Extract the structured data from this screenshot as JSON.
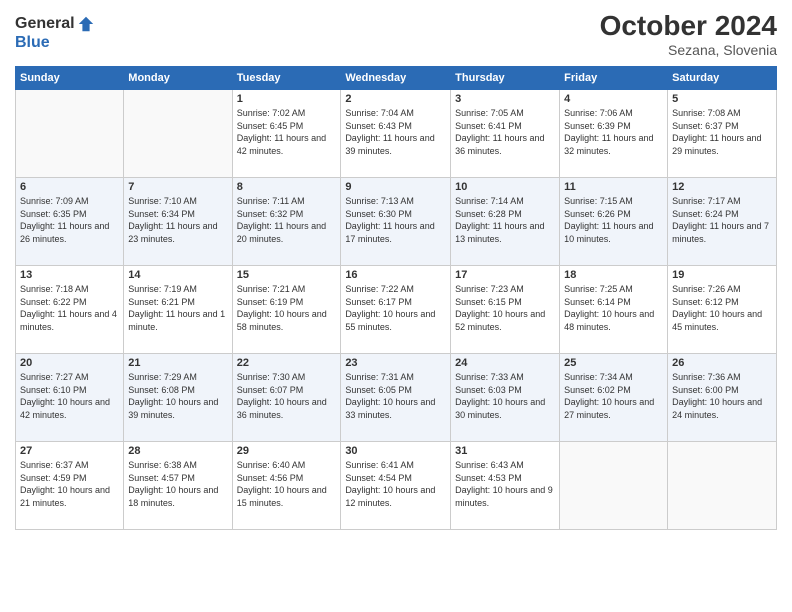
{
  "header": {
    "logo_line1": "General",
    "logo_line2": "Blue",
    "month": "October 2024",
    "location": "Sezana, Slovenia"
  },
  "weekdays": [
    "Sunday",
    "Monday",
    "Tuesday",
    "Wednesday",
    "Thursday",
    "Friday",
    "Saturday"
  ],
  "weeks": [
    [
      {
        "day": "",
        "info": ""
      },
      {
        "day": "",
        "info": ""
      },
      {
        "day": "1",
        "info": "Sunrise: 7:02 AM\nSunset: 6:45 PM\nDaylight: 11 hours and 42 minutes."
      },
      {
        "day": "2",
        "info": "Sunrise: 7:04 AM\nSunset: 6:43 PM\nDaylight: 11 hours and 39 minutes."
      },
      {
        "day": "3",
        "info": "Sunrise: 7:05 AM\nSunset: 6:41 PM\nDaylight: 11 hours and 36 minutes."
      },
      {
        "day": "4",
        "info": "Sunrise: 7:06 AM\nSunset: 6:39 PM\nDaylight: 11 hours and 32 minutes."
      },
      {
        "day": "5",
        "info": "Sunrise: 7:08 AM\nSunset: 6:37 PM\nDaylight: 11 hours and 29 minutes."
      }
    ],
    [
      {
        "day": "6",
        "info": "Sunrise: 7:09 AM\nSunset: 6:35 PM\nDaylight: 11 hours and 26 minutes."
      },
      {
        "day": "7",
        "info": "Sunrise: 7:10 AM\nSunset: 6:34 PM\nDaylight: 11 hours and 23 minutes."
      },
      {
        "day": "8",
        "info": "Sunrise: 7:11 AM\nSunset: 6:32 PM\nDaylight: 11 hours and 20 minutes."
      },
      {
        "day": "9",
        "info": "Sunrise: 7:13 AM\nSunset: 6:30 PM\nDaylight: 11 hours and 17 minutes."
      },
      {
        "day": "10",
        "info": "Sunrise: 7:14 AM\nSunset: 6:28 PM\nDaylight: 11 hours and 13 minutes."
      },
      {
        "day": "11",
        "info": "Sunrise: 7:15 AM\nSunset: 6:26 PM\nDaylight: 11 hours and 10 minutes."
      },
      {
        "day": "12",
        "info": "Sunrise: 7:17 AM\nSunset: 6:24 PM\nDaylight: 11 hours and 7 minutes."
      }
    ],
    [
      {
        "day": "13",
        "info": "Sunrise: 7:18 AM\nSunset: 6:22 PM\nDaylight: 11 hours and 4 minutes."
      },
      {
        "day": "14",
        "info": "Sunrise: 7:19 AM\nSunset: 6:21 PM\nDaylight: 11 hours and 1 minute."
      },
      {
        "day": "15",
        "info": "Sunrise: 7:21 AM\nSunset: 6:19 PM\nDaylight: 10 hours and 58 minutes."
      },
      {
        "day": "16",
        "info": "Sunrise: 7:22 AM\nSunset: 6:17 PM\nDaylight: 10 hours and 55 minutes."
      },
      {
        "day": "17",
        "info": "Sunrise: 7:23 AM\nSunset: 6:15 PM\nDaylight: 10 hours and 52 minutes."
      },
      {
        "day": "18",
        "info": "Sunrise: 7:25 AM\nSunset: 6:14 PM\nDaylight: 10 hours and 48 minutes."
      },
      {
        "day": "19",
        "info": "Sunrise: 7:26 AM\nSunset: 6:12 PM\nDaylight: 10 hours and 45 minutes."
      }
    ],
    [
      {
        "day": "20",
        "info": "Sunrise: 7:27 AM\nSunset: 6:10 PM\nDaylight: 10 hours and 42 minutes."
      },
      {
        "day": "21",
        "info": "Sunrise: 7:29 AM\nSunset: 6:08 PM\nDaylight: 10 hours and 39 minutes."
      },
      {
        "day": "22",
        "info": "Sunrise: 7:30 AM\nSunset: 6:07 PM\nDaylight: 10 hours and 36 minutes."
      },
      {
        "day": "23",
        "info": "Sunrise: 7:31 AM\nSunset: 6:05 PM\nDaylight: 10 hours and 33 minutes."
      },
      {
        "day": "24",
        "info": "Sunrise: 7:33 AM\nSunset: 6:03 PM\nDaylight: 10 hours and 30 minutes."
      },
      {
        "day": "25",
        "info": "Sunrise: 7:34 AM\nSunset: 6:02 PM\nDaylight: 10 hours and 27 minutes."
      },
      {
        "day": "26",
        "info": "Sunrise: 7:36 AM\nSunset: 6:00 PM\nDaylight: 10 hours and 24 minutes."
      }
    ],
    [
      {
        "day": "27",
        "info": "Sunrise: 6:37 AM\nSunset: 4:59 PM\nDaylight: 10 hours and 21 minutes."
      },
      {
        "day": "28",
        "info": "Sunrise: 6:38 AM\nSunset: 4:57 PM\nDaylight: 10 hours and 18 minutes."
      },
      {
        "day": "29",
        "info": "Sunrise: 6:40 AM\nSunset: 4:56 PM\nDaylight: 10 hours and 15 minutes."
      },
      {
        "day": "30",
        "info": "Sunrise: 6:41 AM\nSunset: 4:54 PM\nDaylight: 10 hours and 12 minutes."
      },
      {
        "day": "31",
        "info": "Sunrise: 6:43 AM\nSunset: 4:53 PM\nDaylight: 10 hours and 9 minutes."
      },
      {
        "day": "",
        "info": ""
      },
      {
        "day": "",
        "info": ""
      }
    ]
  ]
}
